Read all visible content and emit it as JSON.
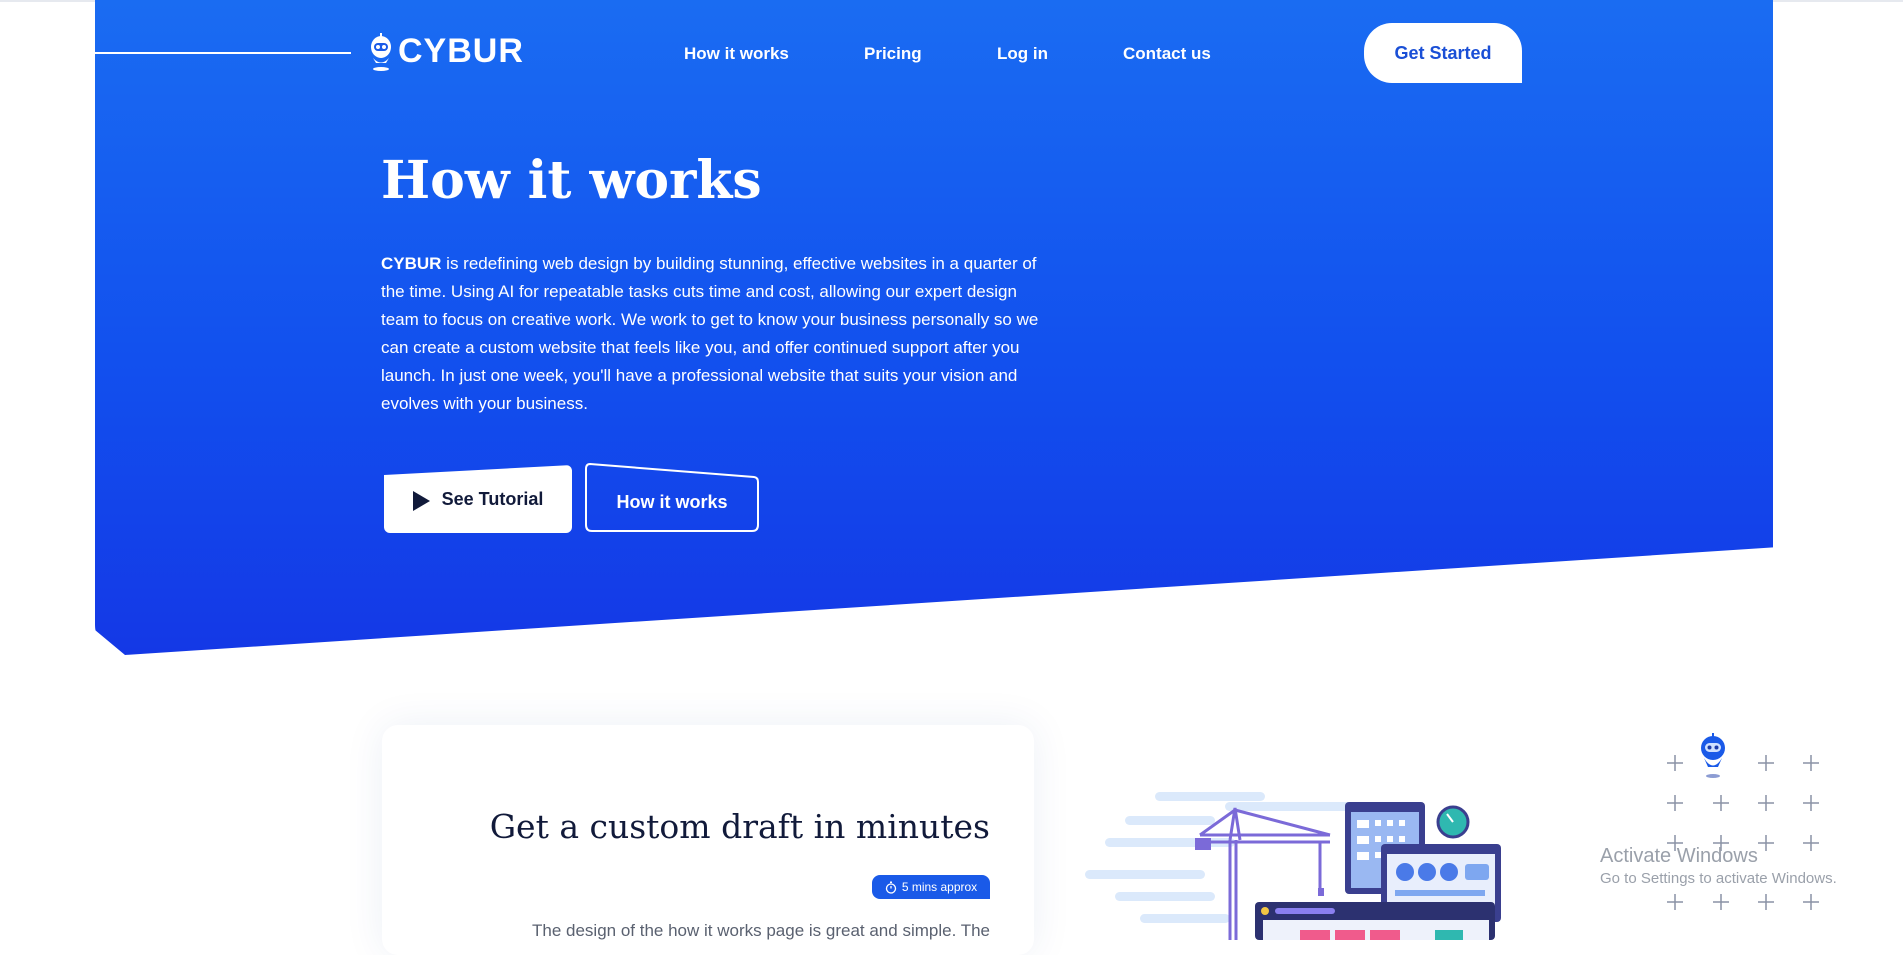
{
  "brand": {
    "name": "CYBUR"
  },
  "nav": {
    "links": [
      "How it works",
      "Pricing",
      "Log in",
      "Contact us"
    ],
    "cta": "Get Started"
  },
  "hero": {
    "title": "How it works",
    "body_brand": "CYBUR",
    "body_text": " is redefining web design by building stunning, effective websites in a quarter of the time. Using AI for repeatable tasks cuts time and cost, allowing our expert design team to focus on creative work. We work to get to know your business personally so we can create a custom website that feels like you, and offer continued support after you launch. In just one week, you'll have a professional website that suits your vision and evolves with your business.",
    "btn_tutorial": "See Tutorial",
    "btn_how": "How it works"
  },
  "step": {
    "title": "Get a custom draft in minutes",
    "badge": "5 mins approx",
    "text": "The design of the how it works page is great and simple. The"
  },
  "watermark": {
    "line1": "Activate Windows",
    "line2": "Go to Settings to activate Windows."
  },
  "colors": {
    "primary": "#1a5ae8",
    "hero_top": "#1a6cf2",
    "hero_bottom": "#1438e6",
    "text_dark": "#111a3a"
  },
  "icons": [
    "robot-logo-icon",
    "play-icon",
    "stopwatch-icon",
    "plus-icon",
    "robot-mascot-icon"
  ]
}
